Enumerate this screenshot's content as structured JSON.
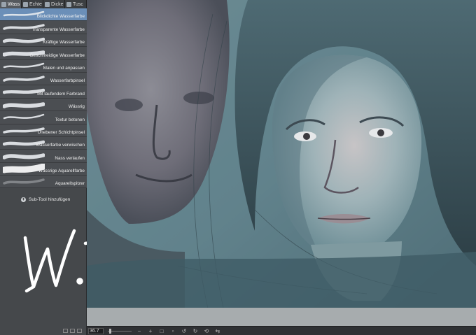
{
  "tabs": [
    {
      "label": "Wass",
      "icon": "watercolor-brush-icon",
      "active": true
    },
    {
      "label": "Echte",
      "icon": "real-brush-icon",
      "active": false
    },
    {
      "label": "Dicke",
      "icon": "thick-paint-icon",
      "active": false
    },
    {
      "label": "Tusc",
      "icon": "ink-brush-icon",
      "active": false
    }
  ],
  "brushes": [
    {
      "label": "Blickdichte Wasserfarbe",
      "selected": true
    },
    {
      "label": "Transparente Wasserfarbe"
    },
    {
      "label": "Kräftige Wasserfarbe"
    },
    {
      "label": "Geschmeidige Wasserfarbe"
    },
    {
      "label": "Malen und anpassen"
    },
    {
      "label": "Wasserfarbpinsel"
    },
    {
      "label": "Mit laufendem Farbrand"
    },
    {
      "label": "Wässrig"
    },
    {
      "label": "Textur betonen"
    },
    {
      "label": "Unebener Schichtpinsel"
    },
    {
      "label": "Wasserfarbe verwischen"
    },
    {
      "label": "Nass verlaufen"
    },
    {
      "label": "Wässrige Aquarellfarbe"
    },
    {
      "label": "Aquarellspitzer"
    }
  ],
  "add_subtool_label": "Sub-Tool hinzufügen",
  "wip_text": "W.I.P.",
  "status": {
    "zoom": "36.7",
    "buttons": [
      "zoom-out",
      "zoom-in",
      "fit",
      "actual-size",
      "rotate-left",
      "rotate-right",
      "reset",
      "flip"
    ]
  },
  "colors": {
    "selected": "#6b8fb8",
    "panel": "#45484b",
    "canvas_bg": "#5f7e86"
  }
}
